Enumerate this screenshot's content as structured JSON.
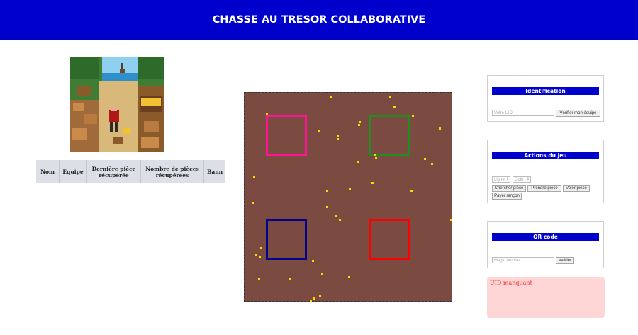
{
  "header": {
    "title": "CHASSE AU TRESOR COLLABORATIVE",
    "bg_color": "#0000cc"
  },
  "table": {
    "columns": [
      "Nom",
      "Equipe",
      "Dernière pièce récupérée",
      "Nombre de pièces récupérées",
      "Bann"
    ]
  },
  "board": {
    "bg_color": "#7b4a41",
    "bases": [
      {
        "name": "pink",
        "color": "#ff1493"
      },
      {
        "name": "green",
        "color": "#228b22"
      },
      {
        "name": "blue",
        "color": "#00008b"
      },
      {
        "name": "red",
        "color": "#ff0000"
      }
    ],
    "coin_color": "#ffd700"
  },
  "identification": {
    "title": "Identification",
    "uid_placeholder": "Votre UID",
    "verify_button": "Vérifier mon équipe"
  },
  "actions": {
    "title": "Actions du jeu",
    "row_placeholder": "Ligne",
    "col_placeholder": "Colo",
    "buttons": [
      "Chercher piece",
      "Prendre piece",
      "Voler piece",
      "Payer rançon"
    ]
  },
  "qr": {
    "title": "QR code",
    "magic_placeholder": "Magic number",
    "validate_button": "Valider"
  },
  "error": {
    "message": "UID manquant"
  }
}
